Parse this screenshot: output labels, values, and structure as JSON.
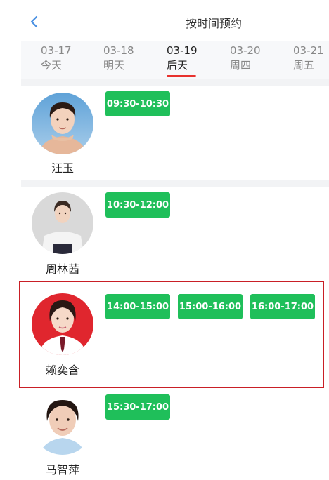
{
  "header": {
    "title": "按时间预约"
  },
  "date_tabs": [
    {
      "date": "03-17",
      "label": "今天",
      "active": false
    },
    {
      "date": "03-18",
      "label": "明天",
      "active": false
    },
    {
      "date": "03-19",
      "label": "后天",
      "active": true
    },
    {
      "date": "03-20",
      "label": "周四",
      "active": false
    },
    {
      "date": "03-21",
      "label": "周五",
      "active": false
    }
  ],
  "doctors": [
    {
      "name": "汪玉",
      "slots": [
        "09:30-10:30"
      ]
    },
    {
      "name": "周林茜",
      "slots": [
        "10:30-12:00"
      ]
    },
    {
      "name": "赖奕含",
      "slots": [
        "14:00-15:00",
        "15:00-16:00",
        "16:00-17:00"
      ]
    },
    {
      "name": "马智萍",
      "slots": [
        "15:30-17:00"
      ]
    }
  ],
  "colors": {
    "slot_green": "#1fbf5a",
    "highlight_red": "#c91f26",
    "tab_underline": "#e8322e",
    "back_blue": "#4a90e2"
  }
}
